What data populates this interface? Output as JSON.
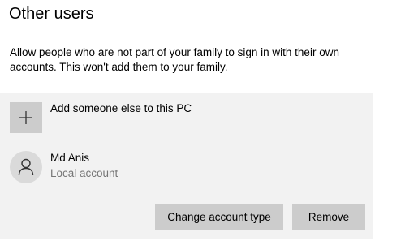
{
  "section": {
    "title": "Other users",
    "description": "Allow people who are not part of your family to sign in with their own accounts. This won't add them to your family."
  },
  "add_user": {
    "icon": "plus-icon",
    "label": "Add someone else to this PC"
  },
  "users": [
    {
      "icon": "person-icon",
      "name": "Md Anis",
      "account_type": "Local account"
    }
  ],
  "actions": {
    "change_account_type_label": "Change account type",
    "remove_label": "Remove"
  },
  "colors": {
    "panel_background": "#f2f2f2",
    "button_background": "#cccccc",
    "secondary_text": "#767676"
  }
}
